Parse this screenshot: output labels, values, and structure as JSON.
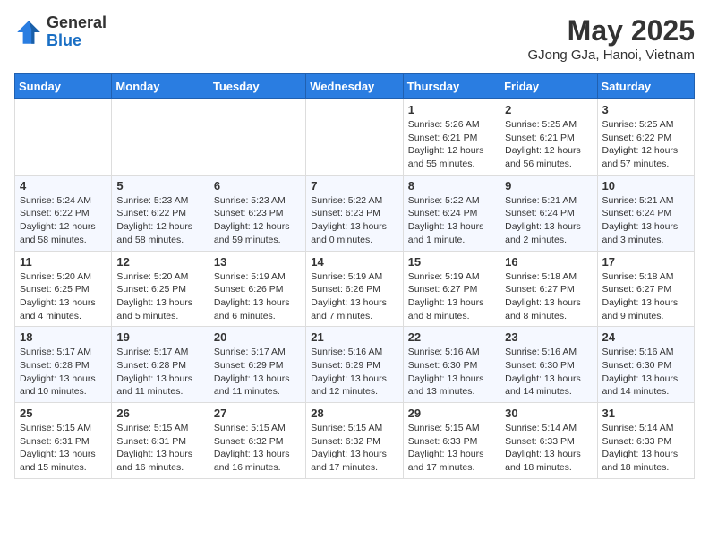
{
  "header": {
    "logo_general": "General",
    "logo_blue": "Blue",
    "month_title": "May 2025",
    "location": "GJong GJa, Hanoi, Vietnam"
  },
  "days_of_week": [
    "Sunday",
    "Monday",
    "Tuesday",
    "Wednesday",
    "Thursday",
    "Friday",
    "Saturday"
  ],
  "weeks": [
    [
      {
        "day": "",
        "info": ""
      },
      {
        "day": "",
        "info": ""
      },
      {
        "day": "",
        "info": ""
      },
      {
        "day": "",
        "info": ""
      },
      {
        "day": "1",
        "info": "Sunrise: 5:26 AM\nSunset: 6:21 PM\nDaylight: 12 hours\nand 55 minutes."
      },
      {
        "day": "2",
        "info": "Sunrise: 5:25 AM\nSunset: 6:21 PM\nDaylight: 12 hours\nand 56 minutes."
      },
      {
        "day": "3",
        "info": "Sunrise: 5:25 AM\nSunset: 6:22 PM\nDaylight: 12 hours\nand 57 minutes."
      }
    ],
    [
      {
        "day": "4",
        "info": "Sunrise: 5:24 AM\nSunset: 6:22 PM\nDaylight: 12 hours\nand 58 minutes."
      },
      {
        "day": "5",
        "info": "Sunrise: 5:23 AM\nSunset: 6:22 PM\nDaylight: 12 hours\nand 58 minutes."
      },
      {
        "day": "6",
        "info": "Sunrise: 5:23 AM\nSunset: 6:23 PM\nDaylight: 12 hours\nand 59 minutes."
      },
      {
        "day": "7",
        "info": "Sunrise: 5:22 AM\nSunset: 6:23 PM\nDaylight: 13 hours\nand 0 minutes."
      },
      {
        "day": "8",
        "info": "Sunrise: 5:22 AM\nSunset: 6:24 PM\nDaylight: 13 hours\nand 1 minute."
      },
      {
        "day": "9",
        "info": "Sunrise: 5:21 AM\nSunset: 6:24 PM\nDaylight: 13 hours\nand 2 minutes."
      },
      {
        "day": "10",
        "info": "Sunrise: 5:21 AM\nSunset: 6:24 PM\nDaylight: 13 hours\nand 3 minutes."
      }
    ],
    [
      {
        "day": "11",
        "info": "Sunrise: 5:20 AM\nSunset: 6:25 PM\nDaylight: 13 hours\nand 4 minutes."
      },
      {
        "day": "12",
        "info": "Sunrise: 5:20 AM\nSunset: 6:25 PM\nDaylight: 13 hours\nand 5 minutes."
      },
      {
        "day": "13",
        "info": "Sunrise: 5:19 AM\nSunset: 6:26 PM\nDaylight: 13 hours\nand 6 minutes."
      },
      {
        "day": "14",
        "info": "Sunrise: 5:19 AM\nSunset: 6:26 PM\nDaylight: 13 hours\nand 7 minutes."
      },
      {
        "day": "15",
        "info": "Sunrise: 5:19 AM\nSunset: 6:27 PM\nDaylight: 13 hours\nand 8 minutes."
      },
      {
        "day": "16",
        "info": "Sunrise: 5:18 AM\nSunset: 6:27 PM\nDaylight: 13 hours\nand 8 minutes."
      },
      {
        "day": "17",
        "info": "Sunrise: 5:18 AM\nSunset: 6:27 PM\nDaylight: 13 hours\nand 9 minutes."
      }
    ],
    [
      {
        "day": "18",
        "info": "Sunrise: 5:17 AM\nSunset: 6:28 PM\nDaylight: 13 hours\nand 10 minutes."
      },
      {
        "day": "19",
        "info": "Sunrise: 5:17 AM\nSunset: 6:28 PM\nDaylight: 13 hours\nand 11 minutes."
      },
      {
        "day": "20",
        "info": "Sunrise: 5:17 AM\nSunset: 6:29 PM\nDaylight: 13 hours\nand 11 minutes."
      },
      {
        "day": "21",
        "info": "Sunrise: 5:16 AM\nSunset: 6:29 PM\nDaylight: 13 hours\nand 12 minutes."
      },
      {
        "day": "22",
        "info": "Sunrise: 5:16 AM\nSunset: 6:30 PM\nDaylight: 13 hours\nand 13 minutes."
      },
      {
        "day": "23",
        "info": "Sunrise: 5:16 AM\nSunset: 6:30 PM\nDaylight: 13 hours\nand 14 minutes."
      },
      {
        "day": "24",
        "info": "Sunrise: 5:16 AM\nSunset: 6:30 PM\nDaylight: 13 hours\nand 14 minutes."
      }
    ],
    [
      {
        "day": "25",
        "info": "Sunrise: 5:15 AM\nSunset: 6:31 PM\nDaylight: 13 hours\nand 15 minutes."
      },
      {
        "day": "26",
        "info": "Sunrise: 5:15 AM\nSunset: 6:31 PM\nDaylight: 13 hours\nand 16 minutes."
      },
      {
        "day": "27",
        "info": "Sunrise: 5:15 AM\nSunset: 6:32 PM\nDaylight: 13 hours\nand 16 minutes."
      },
      {
        "day": "28",
        "info": "Sunrise: 5:15 AM\nSunset: 6:32 PM\nDaylight: 13 hours\nand 17 minutes."
      },
      {
        "day": "29",
        "info": "Sunrise: 5:15 AM\nSunset: 6:33 PM\nDaylight: 13 hours\nand 17 minutes."
      },
      {
        "day": "30",
        "info": "Sunrise: 5:14 AM\nSunset: 6:33 PM\nDaylight: 13 hours\nand 18 minutes."
      },
      {
        "day": "31",
        "info": "Sunrise: 5:14 AM\nSunset: 6:33 PM\nDaylight: 13 hours\nand 18 minutes."
      }
    ]
  ]
}
